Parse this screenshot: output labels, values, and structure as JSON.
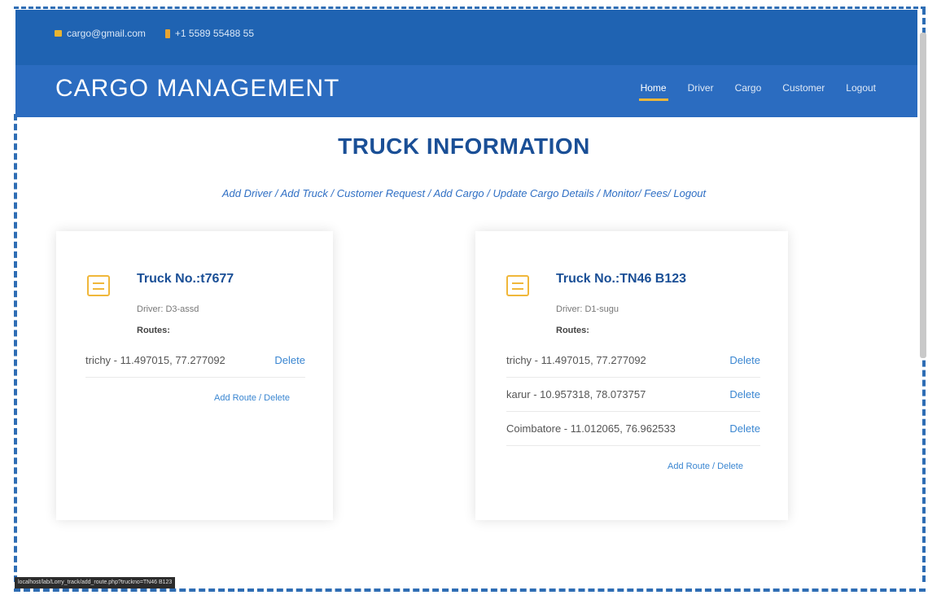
{
  "topbar": {
    "email": "cargo@gmail.com",
    "phone": "+1 5589 55488 55"
  },
  "navbar": {
    "brand": "CARGO MANAGEMENT",
    "links": [
      "Home",
      "Driver",
      "Cargo",
      "Customer",
      "Logout"
    ],
    "active": "Home"
  },
  "main": {
    "title": "TRUCK INFORMATION",
    "sublinks": [
      "Add Driver",
      "Add Truck",
      "Customer Request",
      "Add Cargo",
      "Update Cargo Details",
      "Monitor",
      "Fees",
      "Logout"
    ]
  },
  "trucks": [
    {
      "truck_no": "Truck No.:t7677",
      "driver": "Driver: D3-assd",
      "routes_label": "Routes:",
      "routes": [
        {
          "text": "trichy - 11.497015, 77.277092",
          "action": "Delete"
        }
      ],
      "add_route": "Add Route",
      "delete": "Delete"
    },
    {
      "truck_no": "Truck No.:TN46 B123",
      "driver": "Driver: D1-sugu",
      "routes_label": "Routes:",
      "routes": [
        {
          "text": "trichy - 11.497015, 77.277092",
          "action": "Delete"
        },
        {
          "text": "karur - 10.957318, 78.073757",
          "action": "Delete"
        },
        {
          "text": "Coimbatore - 11.012065, 76.962533",
          "action": "Delete"
        }
      ],
      "add_route": "Add Route",
      "delete": "Delete"
    }
  ],
  "status_bar": "localhost/lab/Lorry_track/add_route.php?truckno=TN46 B123",
  "colors": {
    "header": "#1f63b2",
    "navbar": "#2b6cc0",
    "accent": "#f0b73a",
    "title": "#1a4f96",
    "link": "#3a86d1"
  }
}
